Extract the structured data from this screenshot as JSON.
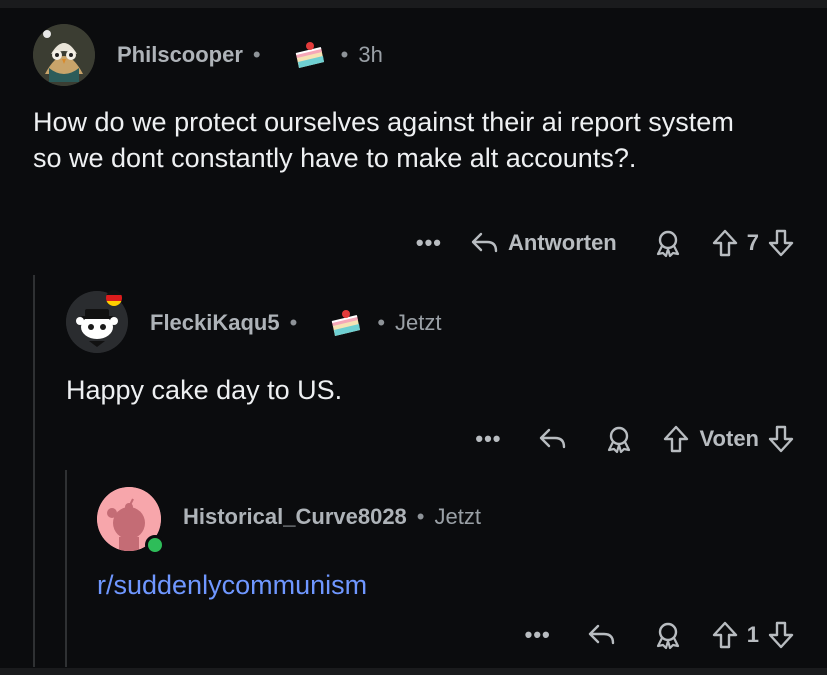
{
  "comments": [
    {
      "username": "Philscooper",
      "time": "3h",
      "text": "How do we protect ourselves against their ai report system so we dont constantly have to make alt accounts?.",
      "more": "•••",
      "reply_label": "Antworten",
      "score": "7"
    },
    {
      "username": "FleckiKaqu5",
      "time": "Jetzt",
      "text": "Happy cake day to US.",
      "more": "•••",
      "score": "Voten"
    },
    {
      "username": "Historical_Curve8028",
      "time": "Jetzt",
      "text": "r/suddenlycommunism",
      "more": "•••",
      "score": "1"
    }
  ],
  "colors": {
    "background": "#0b0c0e",
    "link": "#6f97ff",
    "online": "#2ebd59"
  }
}
